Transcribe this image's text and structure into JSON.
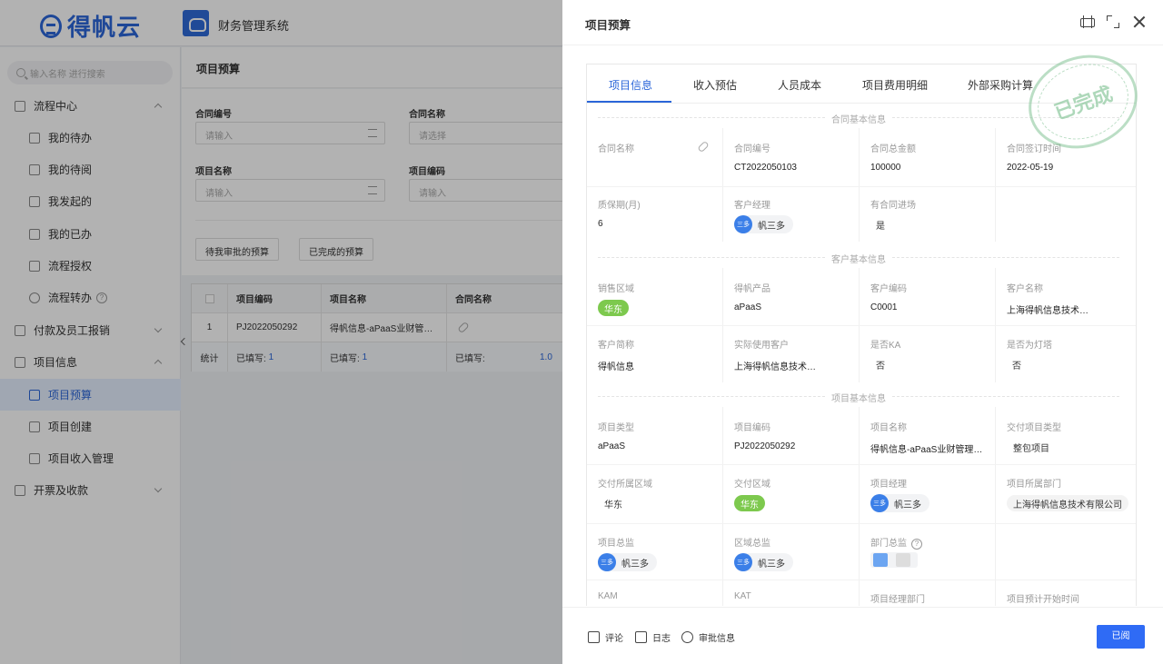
{
  "brand": {
    "logo_text": "得帆云",
    "app_title": "财务管理系统"
  },
  "sidebar": {
    "search_placeholder": "输入名称 进行搜索",
    "groups": [
      {
        "label": "流程中心",
        "items": [
          "我的待办",
          "我的待阅",
          "我发起的",
          "我的已办",
          "流程授权",
          "流程转办"
        ]
      },
      {
        "label": "付款及员工报销"
      },
      {
        "label": "项目信息",
        "items": [
          "项目预算",
          "项目创建",
          "项目收入管理"
        ]
      },
      {
        "label": "开票及收款"
      }
    ],
    "active_item": "项目预算"
  },
  "page": {
    "title": "项目预算",
    "filters": [
      {
        "label": "合同编号",
        "placeholder": "请输入"
      },
      {
        "label": "合同名称",
        "placeholder": "请选择"
      },
      {
        "label": "项目名称",
        "placeholder": "请输入"
      },
      {
        "label": "项目编码",
        "placeholder": "请输入"
      }
    ],
    "buttons": [
      "待我审批的预算",
      "已完成的预算"
    ],
    "table": {
      "headers": [
        "项目编码",
        "项目名称",
        "合同名称"
      ],
      "rows": [
        [
          "1",
          "PJ2022050292",
          "得帆信息-aPaaS业财管…",
          ""
        ]
      ],
      "summary": {
        "label": "统计",
        "filled_label": "已填写:",
        "filled_count": "1",
        "partial_value": "1.0"
      }
    }
  },
  "drawer": {
    "title": "项目预算",
    "tabs": [
      "项目信息",
      "收入预估",
      "人员成本",
      "项目费用明细",
      "外部采购计算"
    ],
    "stamp": "已完成",
    "sections": {
      "contract": "合同基本信息",
      "customer": "客户基本信息",
      "project": "项目基本信息"
    },
    "contract": {
      "contract_name": {
        "label": "合同名称",
        "value": ""
      },
      "contract_no": {
        "label": "合同编号",
        "value": "CT2022050103"
      },
      "amount": {
        "label": "合同总金额",
        "value": "100000"
      },
      "sign_date": {
        "label": "合同签订时间",
        "value": "2022-05-19"
      },
      "warranty": {
        "label": "质保期(月)",
        "value": "6"
      },
      "manager": {
        "label": "客户经理",
        "value": "帆三多",
        "avatar": "三多"
      },
      "in_progress": {
        "label": "有合同进场",
        "value": "是"
      }
    },
    "customer": {
      "region": {
        "label": "销售区域",
        "value": "华东"
      },
      "product": {
        "label": "得帆产品",
        "value": "aPaaS"
      },
      "code": {
        "label": "客户编码",
        "value": "C0001"
      },
      "name": {
        "label": "客户名称",
        "value": "上海得帆信息技术…"
      },
      "short": {
        "label": "客户简称",
        "value": "得帆信息"
      },
      "actual": {
        "label": "实际使用客户",
        "value": "上海得帆信息技术…"
      },
      "ka": {
        "label": "是否KA",
        "value": "否"
      },
      "lighthouse": {
        "label": "是否为灯塔",
        "value": "否"
      }
    },
    "project": {
      "type": {
        "label": "项目类型",
        "value": "aPaaS"
      },
      "code": {
        "label": "项目编码",
        "value": "PJ2022050292"
      },
      "name": {
        "label": "项目名称",
        "value": "得帆信息-aPaaS业财管理…"
      },
      "deliver_type": {
        "label": "交付项目类型",
        "value": "整包项目"
      },
      "deliver_area": {
        "label": "交付所属区域",
        "value": "华东"
      },
      "deliver_region": {
        "label": "交付区域",
        "value": "华东"
      },
      "pm": {
        "label": "项目经理",
        "value": "帆三多",
        "avatar": "三多"
      },
      "dept": {
        "label": "项目所属部门",
        "value": "上海得帆信息技术有限公司"
      },
      "director": {
        "label": "项目总监",
        "value": "帆三多",
        "avatar": "三多"
      },
      "region_director": {
        "label": "区域总监",
        "value": "帆三多",
        "avatar": "三多"
      },
      "dept_director": {
        "label": "部门总监",
        "value": ""
      },
      "kam": {
        "label": "KAM",
        "value": ""
      },
      "kat": {
        "label": "KAT",
        "value": ""
      },
      "pm_dept": {
        "label": "项目经理部门",
        "value": ""
      },
      "start": {
        "label": "项目预计开始时间",
        "value": ""
      }
    },
    "footer": {
      "comment": "评论",
      "log": "日志",
      "approval": "审批信息",
      "done": "已阅"
    }
  }
}
